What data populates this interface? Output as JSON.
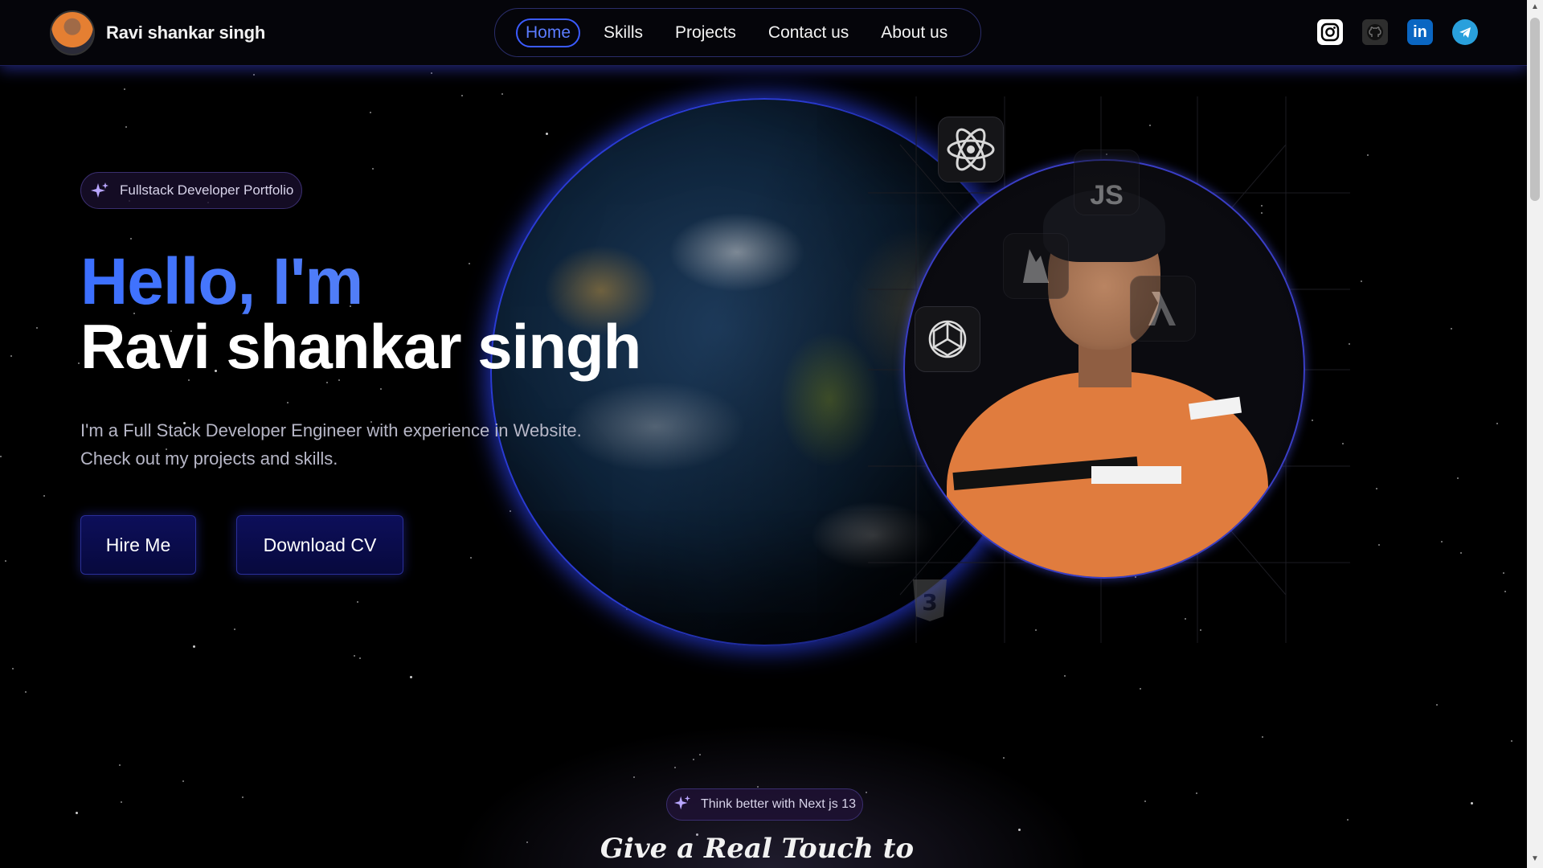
{
  "brand": {
    "name": "Ravi shankar singh"
  },
  "nav": {
    "items": [
      {
        "label": "Home",
        "active": true
      },
      {
        "label": "Skills"
      },
      {
        "label": "Projects"
      },
      {
        "label": "Contact us"
      },
      {
        "label": "About us"
      }
    ]
  },
  "socials": [
    {
      "icon": "instagram-icon"
    },
    {
      "icon": "github-icon"
    },
    {
      "icon": "linkedin-icon",
      "text": "in"
    },
    {
      "icon": "telegram-icon"
    }
  ],
  "hero": {
    "badge": "Fullstack Developer Portfolio",
    "greeting": "Hello, I'm",
    "name": "Ravi shankar singh",
    "tagline_line1": "I'm a Full Stack Developer Engineer with experience in Website.",
    "tagline_line2": "Check out my projects and skills.",
    "hire_button": "Hire Me",
    "cv_button": "Download CV"
  },
  "tech_icons": [
    {
      "name": "react-icon"
    },
    {
      "name": "javascript-icon",
      "text": "JS"
    },
    {
      "name": "firebase-icon"
    },
    {
      "name": "openai-icon"
    },
    {
      "name": "lambda-icon"
    },
    {
      "name": "css3-icon"
    }
  ],
  "next_section": {
    "badge": "Think better with Next js 13",
    "heading": "Give a Real Touch to"
  },
  "colors": {
    "accent_blue": "#3b5bff",
    "button_bg": "#0d0f5a",
    "glow": "#2a3bd4"
  }
}
